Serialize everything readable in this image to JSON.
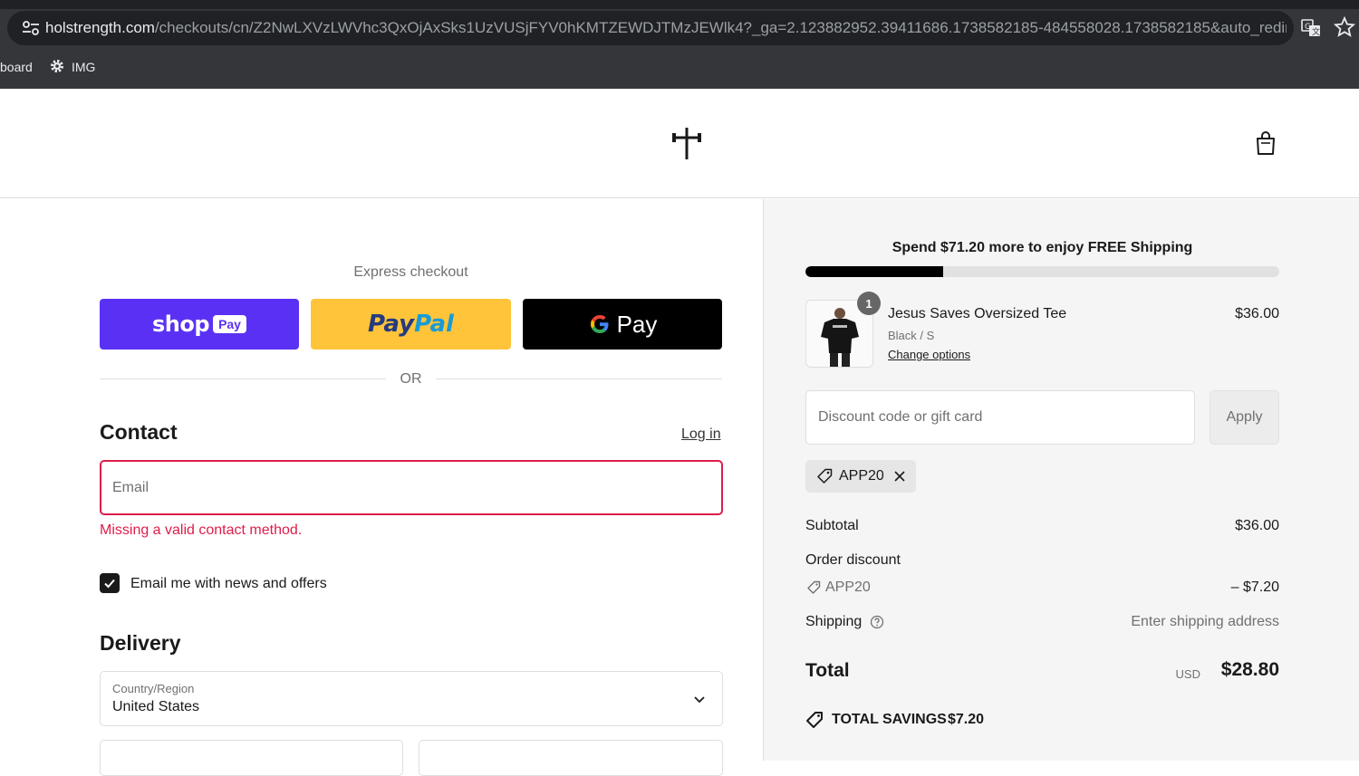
{
  "browser": {
    "url_host": "holstrength.com",
    "url_rest": "/checkouts/cn/Z2NwLXVzLWVhc3QxOjAxSks1UzVUSjFYV0hKMTZEWDJTMzJEWlk4?_ga=2.123882952.39411686.1738582185-484558028.1738582185&auto_redirect=false...",
    "bookmarks": [
      "board",
      "IMG"
    ]
  },
  "header": {
    "logo_icon": "barbell-cross-logo",
    "cart_icon": "shopping-bag-icon"
  },
  "express": {
    "title": "Express checkout",
    "shoppay_word": "shop",
    "shoppay_pill": "Pay",
    "paypal_part1": "Pay",
    "paypal_part2": "Pal",
    "gpay_word": "Pay",
    "or_text": "OR"
  },
  "contact": {
    "title": "Contact",
    "login_label": "Log in",
    "email_placeholder": "Email",
    "email_value": "",
    "error": "Missing a valid contact method.",
    "newsletter_label": "Email me with news and offers",
    "newsletter_checked": true
  },
  "delivery": {
    "title": "Delivery",
    "country_label": "Country/Region",
    "country_value": "United States"
  },
  "summary": {
    "shipping_message": "Spend $71.20 more to enjoy FREE Shipping",
    "shipping_progress": 0.29,
    "item": {
      "quantity": "1",
      "name": "Jesus Saves Oversized Tee",
      "variant": "Black / S",
      "change_label": "Change options",
      "price": "$36.00"
    },
    "discount_placeholder": "Discount code or gift card",
    "apply_label": "Apply",
    "applied_code": "APP20",
    "subtotal_label": "Subtotal",
    "subtotal_value": "$36.00",
    "order_discount_label": "Order discount",
    "discount_code": "APP20",
    "discount_value": "– $7.20",
    "shipping_label": "Shipping",
    "shipping_value": "Enter shipping address",
    "total_label": "Total",
    "total_currency": "USD",
    "total_value": "$28.80",
    "savings_label": "TOTAL SAVINGS",
    "savings_value": "$7.20"
  },
  "colors": {
    "shoppay": "#5a31f4",
    "paypal": "#ffc439",
    "error": "#dd1d4a"
  }
}
